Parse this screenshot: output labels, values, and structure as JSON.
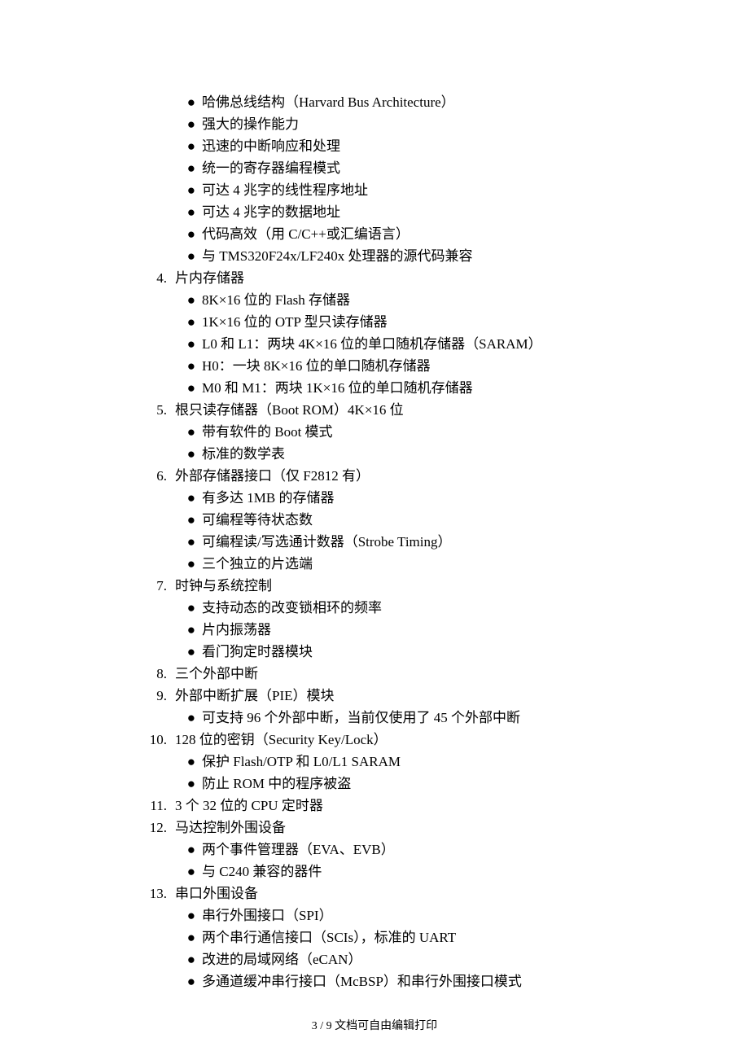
{
  "sections": [
    {
      "num": "",
      "title": "",
      "bullets": [
        "哈佛总线结构（Harvard Bus Architecture）",
        "强大的操作能力",
        "迅速的中断响应和处理",
        "统一的寄存器编程模式",
        "可达 4 兆字的线性程序地址",
        "可达 4 兆字的数据地址",
        "代码高效（用 C/C++或汇编语言）",
        "与 TMS320F24x/LF240x 处理器的源代码兼容"
      ]
    },
    {
      "num": "4.",
      "title": "片内存储器",
      "bullets": [
        "8K×16 位的 Flash 存储器",
        "1K×16 位的 OTP 型只读存储器",
        "L0 和 L1：两块 4K×16 位的单口随机存储器（SARAM）",
        "H0：一块 8K×16 位的单口随机存储器",
        "M0 和 M1：两块 1K×16 位的单口随机存储器"
      ]
    },
    {
      "num": "5.",
      "title": "根只读存储器（Boot ROM）4K×16 位",
      "bullets": [
        "带有软件的 Boot 模式",
        "标准的数学表"
      ]
    },
    {
      "num": "6.",
      "title": "外部存储器接口（仅 F2812 有）",
      "bullets": [
        "有多达 1MB 的存储器",
        "可编程等待状态数",
        "可编程读/写选通计数器（Strobe Timing）",
        "三个独立的片选端"
      ]
    },
    {
      "num": "7.",
      "title": "时钟与系统控制",
      "bullets": [
        "支持动态的改变锁相环的频率",
        "片内振荡器",
        "看门狗定时器模块"
      ]
    },
    {
      "num": "8.",
      "title": "三个外部中断",
      "bullets": []
    },
    {
      "num": "9.",
      "title": "外部中断扩展（PIE）模块",
      "bullets": [
        "可支持 96 个外部中断，当前仅使用了 45 个外部中断"
      ]
    },
    {
      "num": "10.",
      "title": "128 位的密钥（Security Key/Lock）",
      "bullets": [
        "保护 Flash/OTP 和 L0/L1 SARAM",
        "防止 ROM 中的程序被盗"
      ]
    },
    {
      "num": "11.",
      "title": "3 个 32 位的 CPU 定时器",
      "bullets": []
    },
    {
      "num": "12.",
      "title": "马达控制外围设备",
      "bullets": [
        "两个事件管理器（EVA、EVB）",
        "与 C240 兼容的器件"
      ]
    },
    {
      "num": "13.",
      "title": "串口外围设备",
      "bullets": [
        "串行外围接口（SPI）",
        "两个串行通信接口（SCIs），标准的 UART",
        "改进的局域网络（eCAN）",
        "多通道缓冲串行接口（McBSP）和串行外围接口模式"
      ]
    }
  ],
  "footer": "3 / 9 文档可自由编辑打印"
}
